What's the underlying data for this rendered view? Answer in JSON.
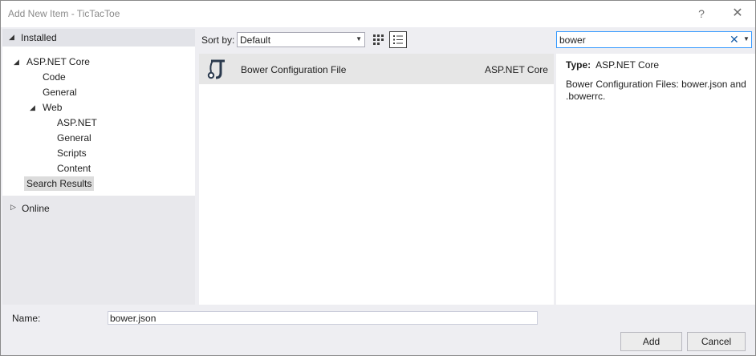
{
  "window": {
    "title": "Add New Item - TicTacToe",
    "help_glyph": "?",
    "close_glyph": "✕"
  },
  "left": {
    "installed_label": "Installed",
    "tree": [
      {
        "label": "ASP.NET Core"
      },
      {
        "label": "Code"
      },
      {
        "label": "General"
      },
      {
        "label": "Web"
      },
      {
        "label": "ASP.NET"
      },
      {
        "label": "General"
      },
      {
        "label": "Scripts"
      },
      {
        "label": "Content"
      },
      {
        "label": "Search Results"
      }
    ],
    "online_label": "Online"
  },
  "toolbar": {
    "sort_label": "Sort by:",
    "sort_value": "Default",
    "search_value": "bower",
    "clear_glyph": "✕"
  },
  "items": [
    {
      "name": "Bower Configuration File",
      "category": "ASP.NET Core",
      "icon": "bower-icon"
    }
  ],
  "details": {
    "type_label": "Type:",
    "type_value": "ASP.NET Core",
    "description": "Bower Configuration Files: bower.json and .bowerrc."
  },
  "footer": {
    "name_label": "Name:",
    "name_value": "bower.json",
    "add_label": "Add",
    "cancel_label": "Cancel"
  },
  "colors": {
    "accent": "#3399ff",
    "selection": "#e6e6e6",
    "background": "#eeeef2"
  }
}
